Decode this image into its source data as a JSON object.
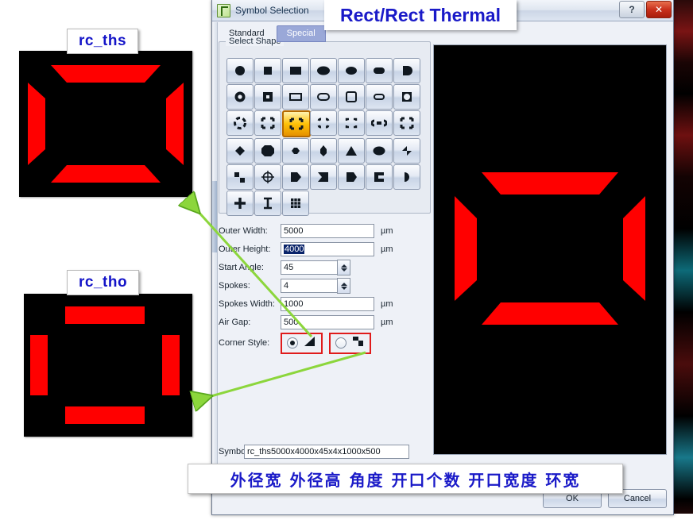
{
  "annotations": {
    "top_banner": "Rect/Rect Thermal",
    "chinese_banner": "外径宽 外径高 角度 开口个数 开口宽度 环宽",
    "pad_label_chamfered": "rc_ths",
    "pad_label_orthogonal": "rc_tho"
  },
  "window": {
    "title": "Symbol Selection",
    "help_label": "?",
    "close_label": "✕"
  },
  "tabs": [
    {
      "label": "Standard",
      "active": false
    },
    {
      "label": "Special",
      "active": true
    }
  ],
  "select_shape": {
    "group_title": "Select Shape",
    "selected_index": 16,
    "shapes": [
      "circle-filled",
      "square-filled",
      "rect-filled",
      "oval-filled-wide",
      "ellipse-filled",
      "rounded-rect-filled",
      "d-shape-filled",
      "donut-ring",
      "square-ring",
      "rect-outline",
      "rounded-rect-outline",
      "square-rounded-outline",
      "oval-outline",
      "circle-in-square",
      "circle-thermal",
      "square-thermal-open",
      "rect-rect-thermal",
      "rounded-thermal",
      "square-thermal-dashed",
      "oval-thermal",
      "square-thermal-x",
      "diamond-filled",
      "octagon-filled",
      "hexagon-flat",
      "hexagon-tall",
      "triangle-filled",
      "ellipse-wide-filled",
      "butterfly-shape",
      "step-corner",
      "target-crosshair",
      "home-plate-right",
      "flag-notch-left",
      "pentagon-right",
      "c-shape",
      "half-circle-right",
      "cross-plus",
      "i-beam",
      "grid-nine"
    ]
  },
  "parameters": [
    {
      "label": "Outer Width:",
      "value": "5000",
      "unit": "µm",
      "type": "text",
      "selected": false
    },
    {
      "label": "Outer Height:",
      "value": "4000",
      "unit": "µm",
      "type": "text",
      "selected": true
    },
    {
      "label": "Start Angle:",
      "value": "45",
      "unit": "",
      "type": "spinner",
      "selected": false
    },
    {
      "label": "Spokes:",
      "value": "4",
      "unit": "",
      "type": "spinner",
      "selected": false
    },
    {
      "label": "Spokes Width:",
      "value": "1000",
      "unit": "µm",
      "type": "text",
      "selected": false
    },
    {
      "label": "Air Gap:",
      "value": "500",
      "unit": "µm",
      "type": "text",
      "selected": false
    }
  ],
  "corner_style": {
    "label": "Corner Style:",
    "options": [
      {
        "icon": "chamfered-corner-icon",
        "selected": true
      },
      {
        "icon": "orthogonal-corner-icon",
        "selected": false
      }
    ]
  },
  "symbol": {
    "label": "Symbol:",
    "value": "rc_ths5000x4000x45x4x1000x500"
  },
  "buttons": {
    "ok": "OK",
    "cancel": "Cancel"
  },
  "colors": {
    "copper_red": "#FF0000",
    "pad_background": "#000000",
    "annotation_blue": "#1A1AC8",
    "highlight_red": "#E01B1B",
    "arrow_green": "#8CD63C",
    "selected_shape_orange": "#FFC107"
  }
}
